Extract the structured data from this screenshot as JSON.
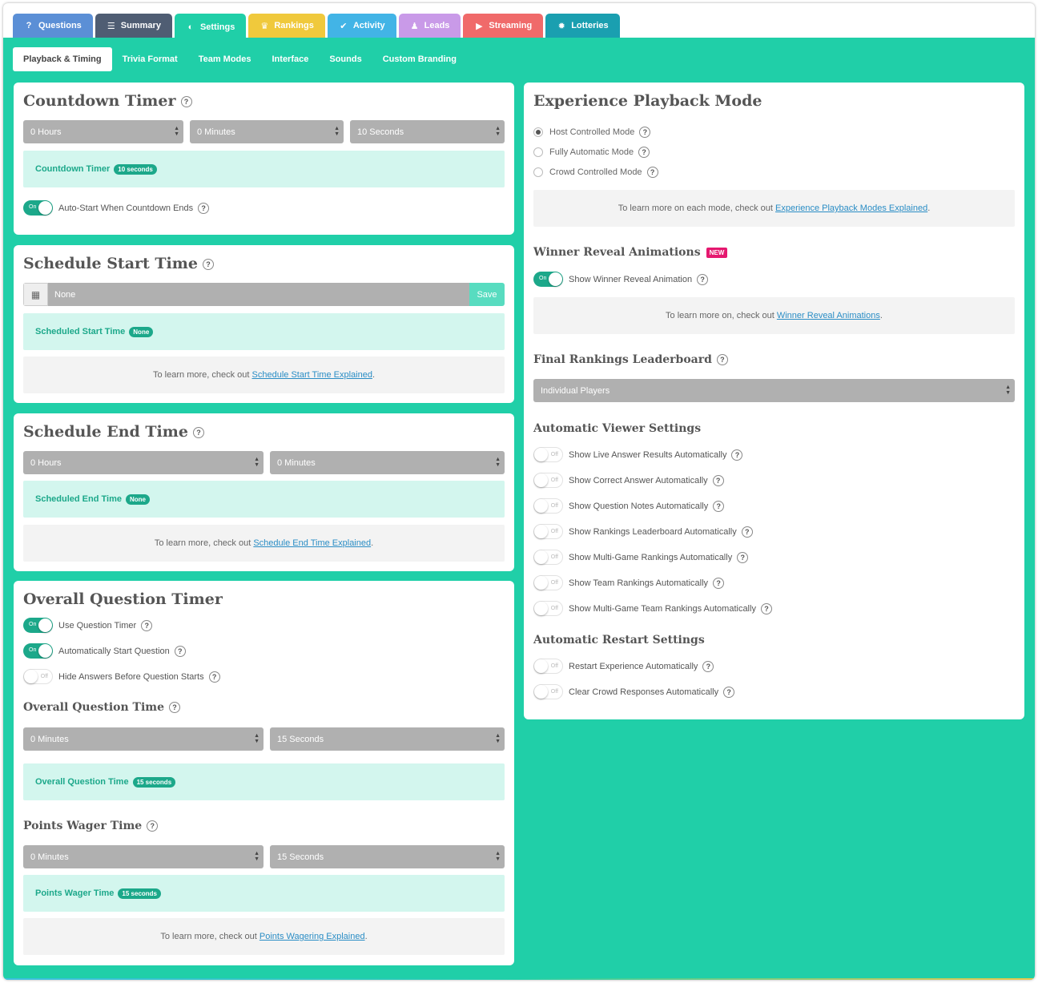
{
  "top_tabs": [
    {
      "label": "Questions",
      "icon": "question-icon",
      "glyph": "?",
      "color": "#5b8fd6"
    },
    {
      "label": "Summary",
      "icon": "summary-icon",
      "glyph": "☰",
      "color": "#4f5d73"
    },
    {
      "label": "Settings",
      "icon": "toggle-icon",
      "glyph": "◐",
      "color": "#20cfa8"
    },
    {
      "label": "Rankings",
      "icon": "trophy-icon",
      "glyph": "♛",
      "color": "#f0c93c"
    },
    {
      "label": "Activity",
      "icon": "check-circle-icon",
      "glyph": "✔",
      "color": "#42b4e6"
    },
    {
      "label": "Leads",
      "icon": "user-icon",
      "glyph": "♟",
      "color": "#c99ae8"
    },
    {
      "label": "Streaming",
      "icon": "video-camera-icon",
      "glyph": "▶",
      "color": "#f06a6a"
    },
    {
      "label": "Lotteries",
      "icon": "gear-icon",
      "glyph": "✹",
      "color": "#1a9fb0"
    }
  ],
  "sub_tabs": [
    "Playback & Timing",
    "Trivia Format",
    "Team Modes",
    "Interface",
    "Sounds",
    "Custom Branding"
  ],
  "countdown": {
    "title": "Countdown Timer",
    "hours": "0 Hours",
    "minutes": "0 Minutes",
    "seconds": "10 Seconds",
    "info_label": "Countdown Timer",
    "info_pill": "10 seconds",
    "auto_start_label": "Auto-Start When Countdown Ends",
    "auto_start_state": "On"
  },
  "schedule_start": {
    "title": "Schedule Start Time",
    "value": "None",
    "save": "Save",
    "info_label": "Scheduled Start Time",
    "info_pill": "None",
    "note_text": "To learn more, check out ",
    "note_link": "Schedule Start Time Explained",
    "note_end": "."
  },
  "schedule_end": {
    "title": "Schedule End Time",
    "hours": "0 Hours",
    "minutes": "0 Minutes",
    "info_label": "Scheduled End Time",
    "info_pill": "None",
    "note_text": "To learn more, check out ",
    "note_link": "Schedule End Time Explained",
    "note_end": "."
  },
  "question_timer": {
    "title": "Overall Question Timer",
    "toggles": [
      {
        "label": "Use Question Timer",
        "state": "On"
      },
      {
        "label": "Automatically Start Question",
        "state": "On"
      },
      {
        "label": "Hide Answers Before Question Starts",
        "state": "Off"
      }
    ],
    "oqt_title": "Overall Question Time",
    "oqt_minutes": "0 Minutes",
    "oqt_seconds": "15 Seconds",
    "oqt_info_label": "Overall Question Time",
    "oqt_info_pill": "15 seconds",
    "pwt_title": "Points Wager Time",
    "pwt_minutes": "0 Minutes",
    "pwt_seconds": "15 Seconds",
    "pwt_info_label": "Points Wager Time",
    "pwt_info_pill": "15 seconds",
    "note_text": "To learn more, check out ",
    "note_link": "Points Wagering Explained",
    "note_end": "."
  },
  "playback": {
    "title": "Experience Playback Mode",
    "modes": [
      {
        "label": "Host Controlled Mode",
        "checked": true
      },
      {
        "label": "Fully Automatic Mode",
        "checked": false
      },
      {
        "label": "Crowd Controlled Mode",
        "checked": false
      }
    ],
    "note_text": "To learn more on each mode, check out ",
    "note_link": "Experience Playback Modes Explained",
    "note_end": ".",
    "winner_title": "Winner Reveal Animations",
    "new_badge": "NEW",
    "winner_toggle_label": "Show Winner Reveal Animation",
    "winner_toggle_state": "On",
    "winner_note_text": "To learn more on, check out ",
    "winner_note_link": "Winner Reveal Animations",
    "winner_note_end": ".",
    "leaderboard_title": "Final Rankings Leaderboard",
    "leaderboard_value": "Individual Players",
    "viewer_title": "Automatic Viewer Settings",
    "viewer_toggles": [
      {
        "label": "Show Live Answer Results Automatically",
        "state": "Off"
      },
      {
        "label": "Show Correct Answer Automatically",
        "state": "Off"
      },
      {
        "label": "Show Question Notes Automatically",
        "state": "Off"
      },
      {
        "label": "Show Rankings Leaderboard Automatically",
        "state": "Off"
      },
      {
        "label": "Show Multi-Game Rankings Automatically",
        "state": "Off"
      },
      {
        "label": "Show Team Rankings Automatically",
        "state": "Off"
      },
      {
        "label": "Show Multi-Game Team Rankings Automatically",
        "state": "Off"
      }
    ],
    "restart_title": "Automatic Restart Settings",
    "restart_toggles": [
      {
        "label": "Restart Experience Automatically",
        "state": "Off"
      },
      {
        "label": "Clear Crowd Responses Automatically",
        "state": "Off"
      }
    ]
  },
  "help_glyph": "?"
}
